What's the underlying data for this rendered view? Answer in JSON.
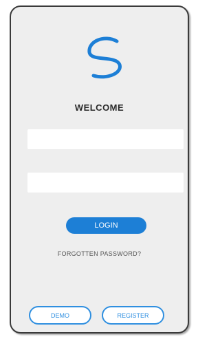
{
  "brand": {
    "logo_icon": "s-swoosh-logo-icon",
    "accent_color": "#1d7fd6"
  },
  "login_form": {
    "welcome_text": "WELCOME",
    "username_value": "",
    "password_value": "",
    "login_label": "LOGIN",
    "forgot_label": "FORGOTTEN PASSWORD?"
  },
  "footer": {
    "demo_label": "DEMO",
    "register_label": "REGISTER"
  }
}
